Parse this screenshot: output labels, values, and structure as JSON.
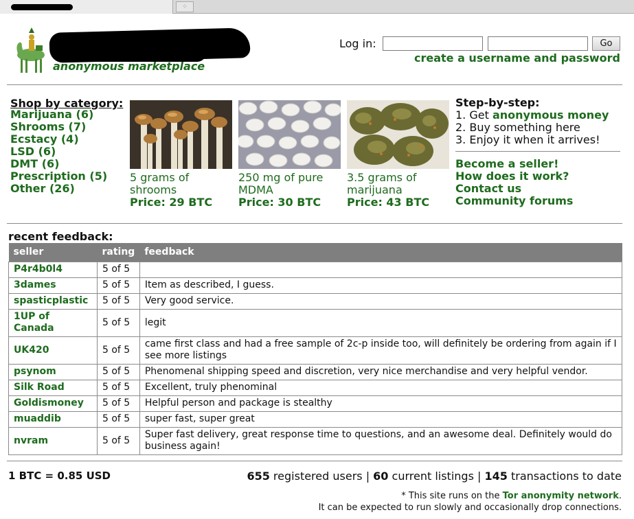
{
  "site": {
    "tagline": "anonymous marketplace"
  },
  "login": {
    "label": "Log in:",
    "username_value": "",
    "password_value": "",
    "go_label": "Go",
    "create_link": "create a username and password"
  },
  "categories": {
    "heading": "Shop by category:",
    "items": [
      "Marijuana (6)",
      "Shrooms (7)",
      "Ecstacy (4)",
      "LSD (6)",
      "DMT (6)",
      "Prescription (5)",
      "Other (26)"
    ]
  },
  "featured": [
    {
      "name": "5 grams of shrooms",
      "price": "Price: 29 BTC",
      "image_icon": "mushrooms-photo"
    },
    {
      "name": "250 mg of pure MDMA",
      "price": "Price: 30 BTC",
      "image_icon": "pills-photo"
    },
    {
      "name": "3.5 grams of marijuana",
      "price": "Price: 43 BTC",
      "image_icon": "marijuana-photo"
    }
  ],
  "steps": {
    "heading": "Step-by-step:",
    "step1_prefix": "1. Get ",
    "step1_link": "anonymous money",
    "step2": "2. Buy something here",
    "step3": "3. Enjoy it when it arrives!"
  },
  "info_links": [
    "Become a seller!",
    "How does it work?",
    "Contact us",
    "Community forums"
  ],
  "feedback": {
    "heading": "recent feedback:",
    "columns": [
      "seller",
      "rating",
      "feedback"
    ],
    "rows": [
      {
        "seller": "P4r4b0l4",
        "rating": "5 of 5",
        "text": ""
      },
      {
        "seller": "3dames",
        "rating": "5 of 5",
        "text": "Item as described, I guess."
      },
      {
        "seller": "spasticplastic",
        "rating": "5 of 5",
        "text": "Very good service."
      },
      {
        "seller": "1UP of Canada",
        "rating": "5 of 5",
        "text": "legit"
      },
      {
        "seller": "UK420",
        "rating": "5 of 5",
        "text": "came first class and had a free sample of 2c-p inside too, will definitely be ordering from again if I see more listings"
      },
      {
        "seller": "psynom",
        "rating": "5 of 5",
        "text": "Phenomenal shipping speed and discretion, very nice merchandise and very helpful vendor."
      },
      {
        "seller": "Silk Road",
        "rating": "5 of 5",
        "text": "Excellent, truly phenominal"
      },
      {
        "seller": "Goldismoney",
        "rating": "5 of 5",
        "text": "Helpful person and package is stealthy"
      },
      {
        "seller": "muaddib",
        "rating": "5 of 5",
        "text": "super fast, super great"
      },
      {
        "seller": "nvram",
        "rating": "5 of 5",
        "text": "Super fast delivery, great response time to questions, and an awesome deal. Definitely would do business again!"
      }
    ]
  },
  "footer": {
    "exchange_rate": "1 BTC = 0.85 USD",
    "users_count": "655",
    "users_label": " registered users | ",
    "listings_count": "60",
    "listings_label": " current listings | ",
    "transactions_count": "145",
    "transactions_label": " transactions to date",
    "tor_prefix": "* This site runs on the ",
    "tor_link": "Tor anonymity network",
    "tor_suffix": ".",
    "tor_note": "It can be expected to run slowly and occasionally drop connections."
  },
  "colors": {
    "link_green": "#1e6b1e",
    "header_gray": "#7f7f7f"
  }
}
